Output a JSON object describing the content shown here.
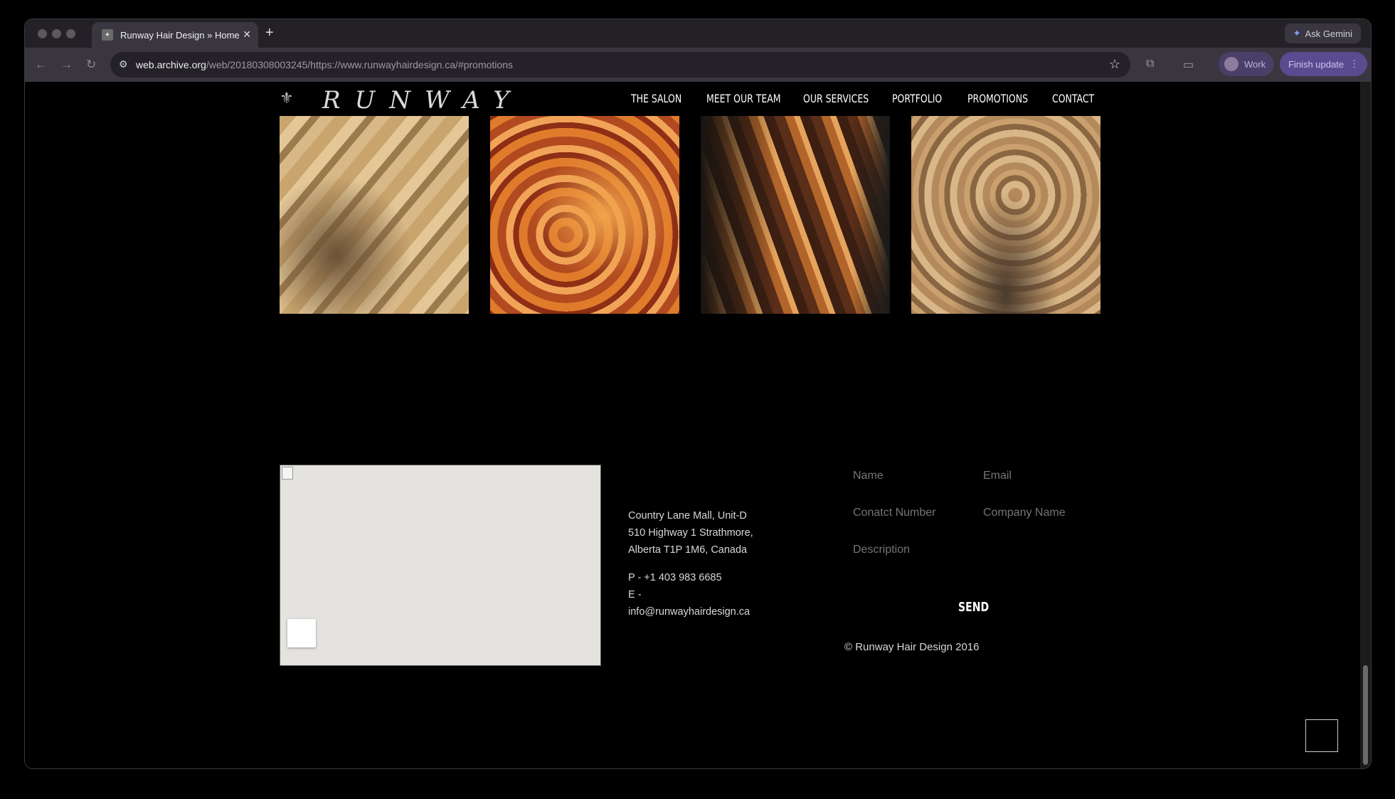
{
  "browser": {
    "tab_title": "Runway Hair Design » Home",
    "url_host": "web.archive.org",
    "url_rest": "/web/20180308003245/https://www.runwayhairdesign.ca/#promotions",
    "ask_gemini": "Ask Gemini",
    "profile": "Work",
    "update": "Finish update"
  },
  "site": {
    "logo_text": "RUNWAY",
    "nav": [
      "THE SALON",
      "MEET OUR TEAM",
      "OUR SERVICES",
      "PORTFOLIO",
      "PROMOTIONS",
      "CONTACT"
    ]
  },
  "contact": {
    "address": [
      "Country Lane Mall, Unit-D",
      "510 Highway 1 Strathmore,",
      "Alberta T1P 1M6, Canada"
    ],
    "phone": "P - +1 403 983 6685",
    "email_label": "E -",
    "email": "info@runwayhairdesign.ca"
  },
  "form": {
    "name_placeholder": "Name",
    "email_placeholder": "Email",
    "contact_placeholder": "Conatct Number",
    "company_placeholder": "Company Name",
    "description_placeholder": "Description",
    "send_label": "SEND"
  },
  "footer": {
    "copyright": "© Runway Hair Design 2016"
  }
}
